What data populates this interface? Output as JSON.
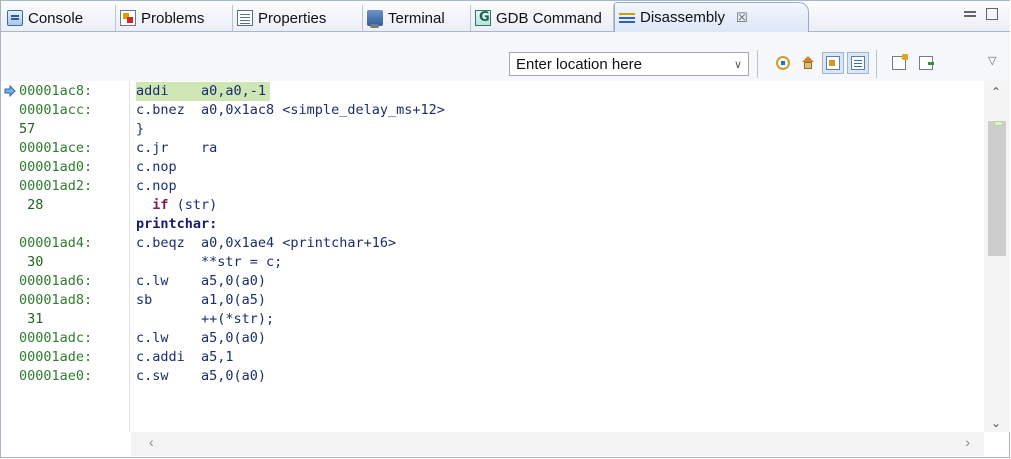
{
  "tabs": [
    {
      "label": "Console",
      "icon": "console-icon"
    },
    {
      "label": "Problems",
      "icon": "problems-icon"
    },
    {
      "label": "Properties",
      "icon": "properties-icon"
    },
    {
      "label": "Terminal",
      "icon": "terminal-icon"
    },
    {
      "label": "GDB Command",
      "icon": "gdb-command-icon"
    },
    {
      "label": "Disassembly",
      "icon": "disassembly-icon",
      "active": true,
      "close": "☒"
    }
  ],
  "toolbar": {
    "location_placeholder": "Enter location here",
    "buttons": [
      "link-with-active-context-icon",
      "home-icon",
      "show-source-icon",
      "show-symbols-icon",
      "export-icon",
      "import-icon"
    ]
  },
  "lines": [
    {
      "addr": "00001ac8:",
      "text": "addi    a0,a0,-1",
      "current": true
    },
    {
      "addr": "00001acc:",
      "text": "c.bnez  a0,0x1ac8 <simple_delay_ms+12>"
    },
    {
      "addr": "57",
      "text": "}",
      "src": true
    },
    {
      "addr": "00001ace:",
      "text": "c.jr    ra"
    },
    {
      "addr": "00001ad0:",
      "text": "c.nop"
    },
    {
      "addr": "00001ad2:",
      "text": "c.nop"
    },
    {
      "addr": " 28",
      "text": "  if (str)",
      "src": true,
      "kw": "if"
    },
    {
      "addr": "",
      "text": "printchar:",
      "func": true
    },
    {
      "addr": "00001ad4:",
      "text": "c.beqz  a0,0x1ae4 <printchar+16>"
    },
    {
      "addr": " 30",
      "text": "        **str = c;",
      "src": true
    },
    {
      "addr": "00001ad6:",
      "text": "c.lw    a5,0(a0)"
    },
    {
      "addr": "00001ad8:",
      "text": "sb      a1,0(a5)"
    },
    {
      "addr": " 31",
      "text": "        ++(*str);",
      "src": true
    },
    {
      "addr": "00001adc:",
      "text": "c.lw    a5,0(a0)"
    },
    {
      "addr": "00001ade:",
      "text": "c.addi  a5,1"
    },
    {
      "addr": "00001ae0:",
      "text": "c.sw    a5,0(a0)"
    }
  ],
  "colors": {
    "address": "#2f7d2f",
    "code": "#1b2e6b",
    "current_line": "#cfe6b5"
  }
}
